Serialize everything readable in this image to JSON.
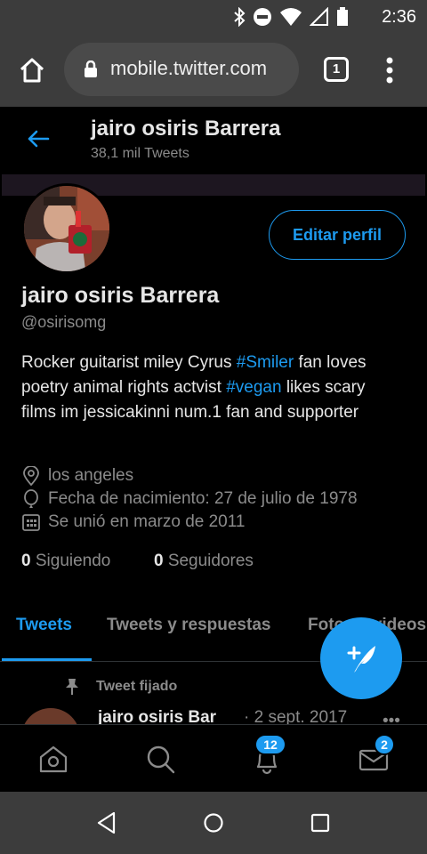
{
  "status_bar": {
    "time": "2:36"
  },
  "browser": {
    "url": "mobile.twitter.com",
    "tab_count": "1"
  },
  "header": {
    "title": "jairo osiris Barrera",
    "subtitle": "38,1 mil Tweets"
  },
  "profile": {
    "edit_label": "Editar perfil",
    "name": "jairo osiris Barrera",
    "handle": "@osirisomg",
    "bio": {
      "part1": "Rocker  guitarist  miley Cyrus ",
      "tag1": "#Smiler",
      "part2": " fan loves poetry animal rights actvist  ",
      "tag2": "#vegan",
      "part3": " likes scary films im jessicakinni num.1 fan and supporter"
    },
    "location": "los angeles",
    "birthday": "Fecha de nacimiento: 27 de julio de 1978",
    "joined": "Se unió en marzo de 2011",
    "following_count": "0",
    "following_label": "Siguiendo",
    "followers_count": "0",
    "followers_label": "Seguidores"
  },
  "tabs": [
    {
      "label": "Tweets"
    },
    {
      "label": "Tweets y respuestas"
    },
    {
      "label": "Fotos y videos"
    }
  ],
  "pinned": {
    "label": "Tweet fijado",
    "name": "jairo osiris Bar",
    "date": "· 2 sept. 2017",
    "more": "•••"
  },
  "bottom_nav": {
    "notifications_badge": "12",
    "messages_badge": "2"
  },
  "colors": {
    "accent": "#1d9bf0",
    "background": "#000000",
    "chrome": "#3c3c3c"
  }
}
